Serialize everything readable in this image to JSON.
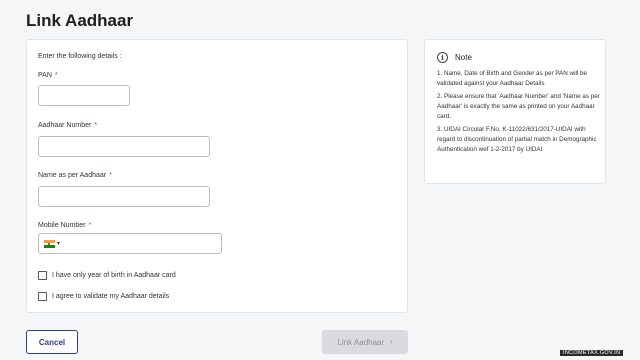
{
  "page": {
    "title": "Link Aadhaar"
  },
  "form": {
    "intro": "Enter the following details :",
    "fields": [
      {
        "label": "PAN",
        "required": "*",
        "value": ""
      },
      {
        "label": "Aadhaar Number",
        "required": "*",
        "value": ""
      },
      {
        "label": "Name as per Aadhaar",
        "required": "*",
        "value": ""
      },
      {
        "label": "Mobile Number",
        "required": "*",
        "value": ""
      }
    ],
    "country_flag_icon": "india-flag-icon",
    "checkboxes": [
      {
        "label": "I have only year of birth in Aadhaar card",
        "checked": false
      },
      {
        "label": "I agree to validate my Aadhaar details",
        "checked": false
      }
    ]
  },
  "note": {
    "title": "Note",
    "icon": "info-icon",
    "items": [
      "1. Name, Date of Birth and Gender as per PAN will be validated against your Aadhaar Details",
      "2. Please ensure that 'Aadhaar Number' and 'Name as per Aadhaar' is exactly the same as printed on your Aadhaar card.",
      "3. UIDAI Circular F.No. K-11022/631/2017-UIDAI with regard to discontinuation of partial match in Demographic Authentication wef 1-2-2017 by UIDAI"
    ]
  },
  "actions": {
    "cancel_label": "Cancel",
    "submit_label": "Link Aadhaar",
    "submit_icon": "chevron-right-icon"
  },
  "watermark": "INCOMETAX.GOV.IN",
  "colors": {
    "accent": "#2c3e8f",
    "required": "#d0342c",
    "disabled_bg": "#d9dbe0",
    "page_bg": "#f5f6f8"
  }
}
